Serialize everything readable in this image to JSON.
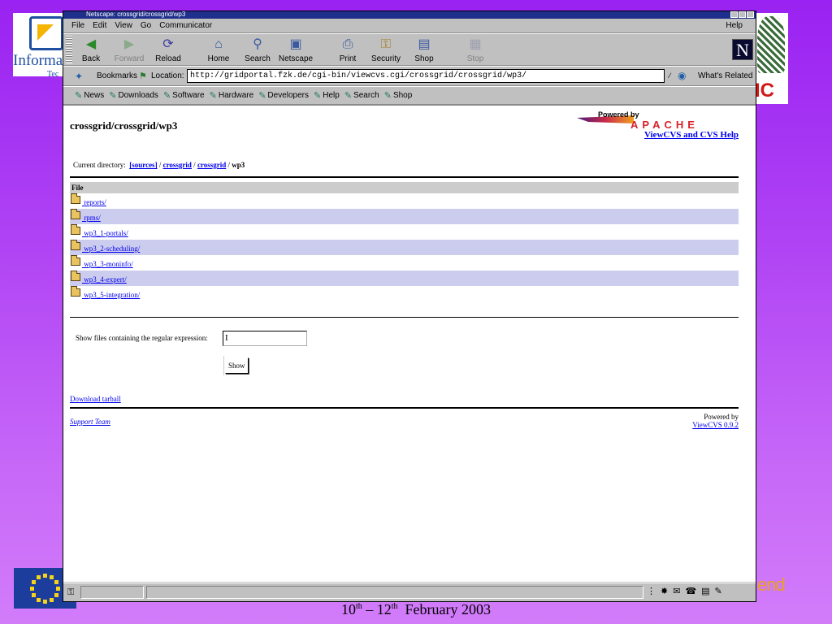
{
  "slide": {
    "logo_left_text": "Informa",
    "logo_left_sub": "Tec",
    "logo_right_text": "IC",
    "corner_text": "end",
    "footer": {
      "day1": "10",
      "sup1": "th",
      "dash": " – ",
      "day2": "12",
      "sup2": "th",
      "month_year": "  February 2003"
    }
  },
  "browser": {
    "title": "Netscape: crossgrid/crossgrid/wp3",
    "menu": [
      "File",
      "Edit",
      "View",
      "Go",
      "Communicator"
    ],
    "menu_help": "Help",
    "toolbar": {
      "back": "Back",
      "forward": "Forward",
      "reload": "Reload",
      "home": "Home",
      "search": "Search",
      "netscape": "Netscape",
      "print": "Print",
      "security": "Security",
      "shop": "Shop",
      "stop": "Stop"
    },
    "location": {
      "bookmarks_label": "Bookmarks",
      "location_label": "Location:",
      "url": "http://gridportal.fzk.de/cgi-bin/viewcvs.cgi/crossgrid/crossgrid/wp3/",
      "whats_related": "What's Related"
    },
    "personal": [
      "News",
      "Downloads",
      "Software",
      "Hardware",
      "Developers",
      "Help",
      "Search",
      "Shop"
    ]
  },
  "page": {
    "title": "crossgrid/crossgrid/wp3",
    "powered_by": "Powered by",
    "apache": "APACHE",
    "help_link": "ViewCVS and CVS Help",
    "curdir_label": "Current directory:",
    "curdir_parts": [
      "[sources]",
      "crossgrid",
      "crossgrid"
    ],
    "curdir_sep": " / ",
    "curdir_current": "wp3",
    "table_header": "File",
    "files": [
      " reports/",
      " rpms/",
      " wp3_1-portals/",
      " wp3_2-scheduling/",
      " wp3_3-moninfo/",
      " wp3_4-expert/",
      " wp3_5-integration/"
    ],
    "regex_label": "Show files containing the regular expression:",
    "regex_value": "I",
    "show_button": "Show",
    "tarball": "Download tarball",
    "support": "Support Team",
    "footer_powered": "Powered by",
    "viewcvs_version": "ViewCVS 0.9.2"
  },
  "colors": {
    "link": "#0000ee",
    "row_shade": "#ccccee",
    "header_bg": "#cccccc",
    "titlebar": "#1f2f8c"
  }
}
